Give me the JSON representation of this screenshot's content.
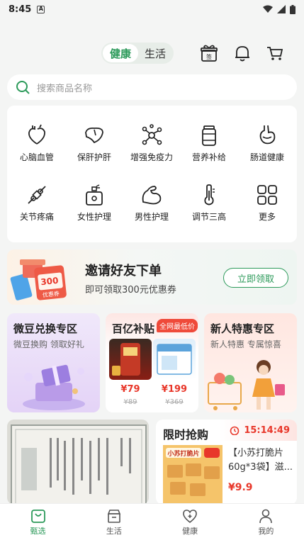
{
  "status_bar": {
    "time": "8:45",
    "notification_icon": "A"
  },
  "header": {
    "segments": [
      {
        "label": "健康",
        "active": true
      },
      {
        "label": "生活",
        "active": false
      }
    ],
    "icons": [
      "gift-icon",
      "bell-icon",
      "cart-icon"
    ]
  },
  "search": {
    "placeholder": "搜索商品名称"
  },
  "categories": [
    {
      "label": "心脑血管",
      "icon": "heart-icon"
    },
    {
      "label": "保肝护肝",
      "icon": "liver-icon"
    },
    {
      "label": "增强免疫力",
      "icon": "molecule-icon"
    },
    {
      "label": "营养补给",
      "icon": "supplement-bottle-icon"
    },
    {
      "label": "肠道健康",
      "icon": "stomach-icon"
    },
    {
      "label": "关节疼痛",
      "icon": "joint-icon"
    },
    {
      "label": "女性护理",
      "icon": "perfume-icon"
    },
    {
      "label": "男性护理",
      "icon": "muscle-icon"
    },
    {
      "label": "调节三高",
      "icon": "thermometer-icon"
    },
    {
      "label": "更多",
      "icon": "grid-more-icon"
    }
  ],
  "invite_banner": {
    "title": "邀请好友下单",
    "subtitle": "即可领取300元优惠券",
    "button": "立即领取",
    "coupon_amount": "300",
    "coupon_text": "优惠券"
  },
  "promo_cards": [
    {
      "title": "微豆兑换专区",
      "subtitle": "微豆换购 领取好礼"
    },
    {
      "title": "百亿补贴",
      "badge": "全网最低价",
      "products": [
        {
          "price": "¥79",
          "original": "¥89"
        },
        {
          "price": "¥199",
          "original": "¥369"
        }
      ]
    },
    {
      "title": "新人特惠专区",
      "subtitle": "新人特惠 专属惊喜"
    }
  ],
  "flash_sale": {
    "title": "限时抢购",
    "countdown": "15:14:49",
    "product_name": "【小苏打脆片60g*3袋】滋...",
    "product_price": "¥9.9",
    "image_label": "小苏打脆片"
  },
  "tabbar": [
    {
      "label": "甄选",
      "active": true
    },
    {
      "label": "生活",
      "active": false
    },
    {
      "label": "健康",
      "active": false
    },
    {
      "label": "我的",
      "active": false
    }
  ],
  "colors": {
    "accent": "#2c9a5a",
    "price": "#e8372a"
  }
}
